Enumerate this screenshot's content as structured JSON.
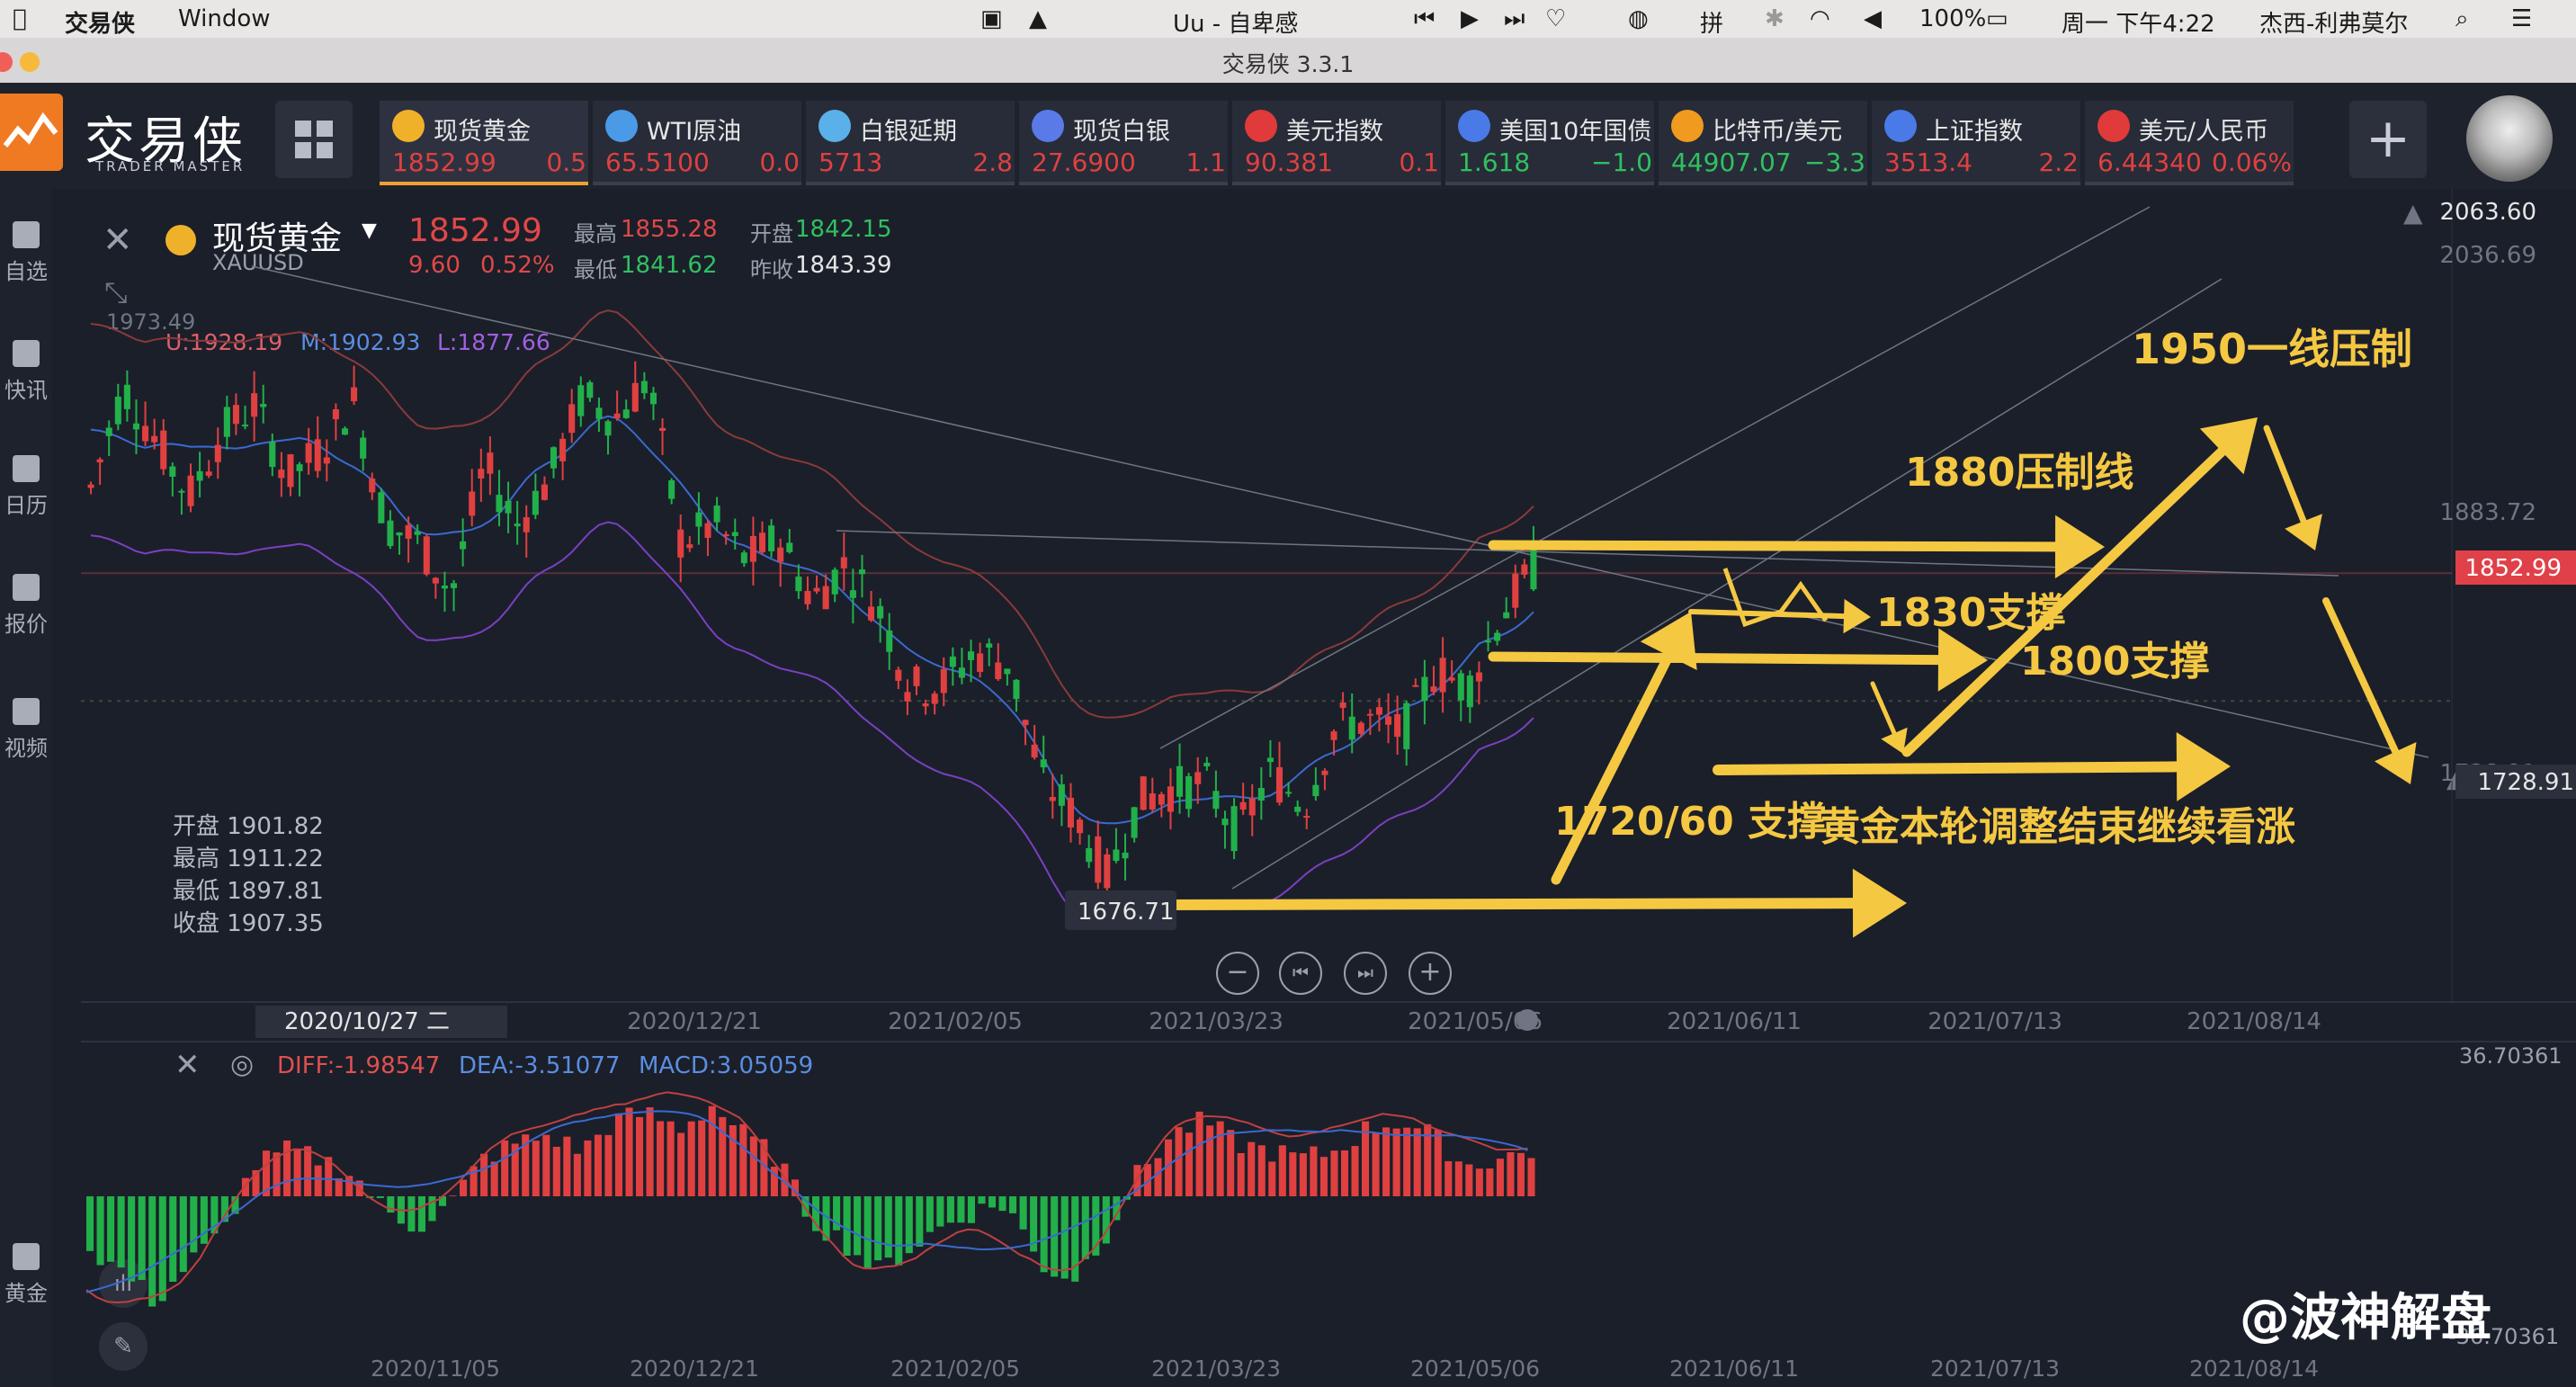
{
  "menubar": {
    "app_name": "交易侠",
    "menu_window": "Window",
    "uu_text": "Uu - 自卑感",
    "battery": "100%",
    "clock": "周一 下午4:22",
    "user": "杰西-利弗莫尔"
  },
  "window": {
    "title": "交易侠 3.3.1"
  },
  "logo": {
    "name": "交易侠",
    "tagline": "TRADER MASTER"
  },
  "tickers": [
    {
      "name": "现货黄金",
      "price": "1852.99",
      "change": "0.5",
      "color": "#e04040",
      "icon": "gold-icon"
    },
    {
      "name": "WTI原油",
      "price": "65.5100",
      "change": "0.0",
      "color": "#e04040",
      "icon": "oil-icon"
    },
    {
      "name": "白银延期",
      "price": "5713",
      "change": "2.8",
      "color": "#e04040",
      "icon": "silver-icon"
    },
    {
      "name": "现货白银",
      "price": "27.6900",
      "change": "1.1",
      "color": "#e04040",
      "icon": "silver-spot-icon"
    },
    {
      "name": "美元指数",
      "price": "90.381",
      "change": "0.1",
      "color": "#e04040",
      "icon": "us-flag-icon"
    },
    {
      "name": "美国10年国债",
      "price": "1.618",
      "change": "−1.0",
      "color": "#30c060",
      "icon": "bond-icon"
    },
    {
      "name": "比特币/美元",
      "price": "44907.07",
      "change": "−3.3",
      "color": "#30c060",
      "icon": "bitcoin-icon"
    },
    {
      "name": "上证指数",
      "price": "3513.4",
      "change": "2.2",
      "color": "#e04040",
      "icon": "index-icon"
    },
    {
      "name": "美元/人民币",
      "price": "6.44340",
      "change": "0.06%",
      "color": "#e04040",
      "icon": "cn-flag-icon"
    }
  ],
  "sidebar": [
    {
      "label": "自选",
      "icon": "bookmark-icon"
    },
    {
      "label": "快讯",
      "icon": "news-icon"
    },
    {
      "label": "日历",
      "icon": "calendar-icon"
    },
    {
      "label": "报价",
      "icon": "quote-icon"
    },
    {
      "label": "视频",
      "icon": "video-icon"
    },
    {
      "label": "黄金",
      "icon": "sge-icon"
    }
  ],
  "symbol": {
    "name": "现货黄金",
    "code": "XAUUSD",
    "price": "1852.99",
    "change": "9.60",
    "change_pct": "0.52%",
    "high_label": "最高",
    "high": "1855.28",
    "open_label": "开盘",
    "open": "1842.15",
    "low_label": "最低",
    "low": "1841.62",
    "prev_label": "昨收",
    "prev": "1843.39"
  },
  "bollinger": {
    "upper": "U:1928.19",
    "mid": "M:1902.93",
    "lower": "L:1877.66",
    "top_left_value": "1973.49"
  },
  "ohlc_box": {
    "open": "开盘 1901.82",
    "high": "最高 1911.22",
    "low": "最低 1897.81",
    "close": "收盘 1907.35"
  },
  "macd": {
    "diff": "DIFF:-1.98547",
    "dea": "DEA:-3.51077",
    "macd": "MACD:3.05059",
    "max_label": "36.70361",
    "min_label": "-36.70361"
  },
  "annotations": {
    "a1950": "1950一线压制",
    "a1880": "1880压制线",
    "a1830": "1830支撑",
    "a1800": "1800支撑",
    "a1720": "1720/60 支撑",
    "conclusion": "黄金本轮调整结束继续看涨",
    "low_marker": "1676.71"
  },
  "watermark": "@波神解盘",
  "chart_data": {
    "type": "candlestick",
    "title": "",
    "price_axis_labels": [
      "2063.60",
      "2036.69",
      "1883.72",
      "1852.99",
      "1728.91"
    ],
    "current_price": 1852.99,
    "x_tick_labels": [
      "2020/10/27 二",
      "2020/12/21",
      "2021/02/05",
      "2021/03/23",
      "2021/05/06",
      "2021/06/11",
      "2021/07/13",
      "2021/08/14"
    ],
    "macd_x_tick_labels": [
      "2020/11/05",
      "2020/12/21",
      "2021/02/05",
      "2021/03/23",
      "2021/05/06",
      "2021/06/11",
      "2021/07/13",
      "2021/08/14"
    ],
    "ylim": [
      1620,
      2063.6
    ],
    "close_path": [
      1900,
      1955,
      1925,
      1895,
      1930,
      1945,
      1905,
      1920,
      1948,
      1880,
      1870,
      1842,
      1912,
      1880,
      1905,
      1950,
      1938,
      1960,
      1870,
      1880,
      1860,
      1872,
      1838,
      1858,
      1835,
      1790,
      1792,
      1810,
      1803,
      1740,
      1720,
      1687,
      1728,
      1735,
      1738,
      1710,
      1744,
      1725,
      1770,
      1772,
      1765,
      1800,
      1790,
      1830,
      1855
    ],
    "volume_line_y": 1783,
    "macd_values": [
      -14,
      -20,
      -28,
      -18,
      -10,
      8,
      12,
      10,
      6,
      -4,
      -8,
      -2,
      10,
      14,
      16,
      12,
      20,
      22,
      18,
      24,
      16,
      10,
      -6,
      -12,
      -20,
      -14,
      -8,
      -4,
      -2,
      -18,
      -22,
      -10,
      6,
      16,
      20,
      14,
      12,
      10,
      12,
      18,
      20,
      16,
      8,
      10,
      12
    ]
  }
}
